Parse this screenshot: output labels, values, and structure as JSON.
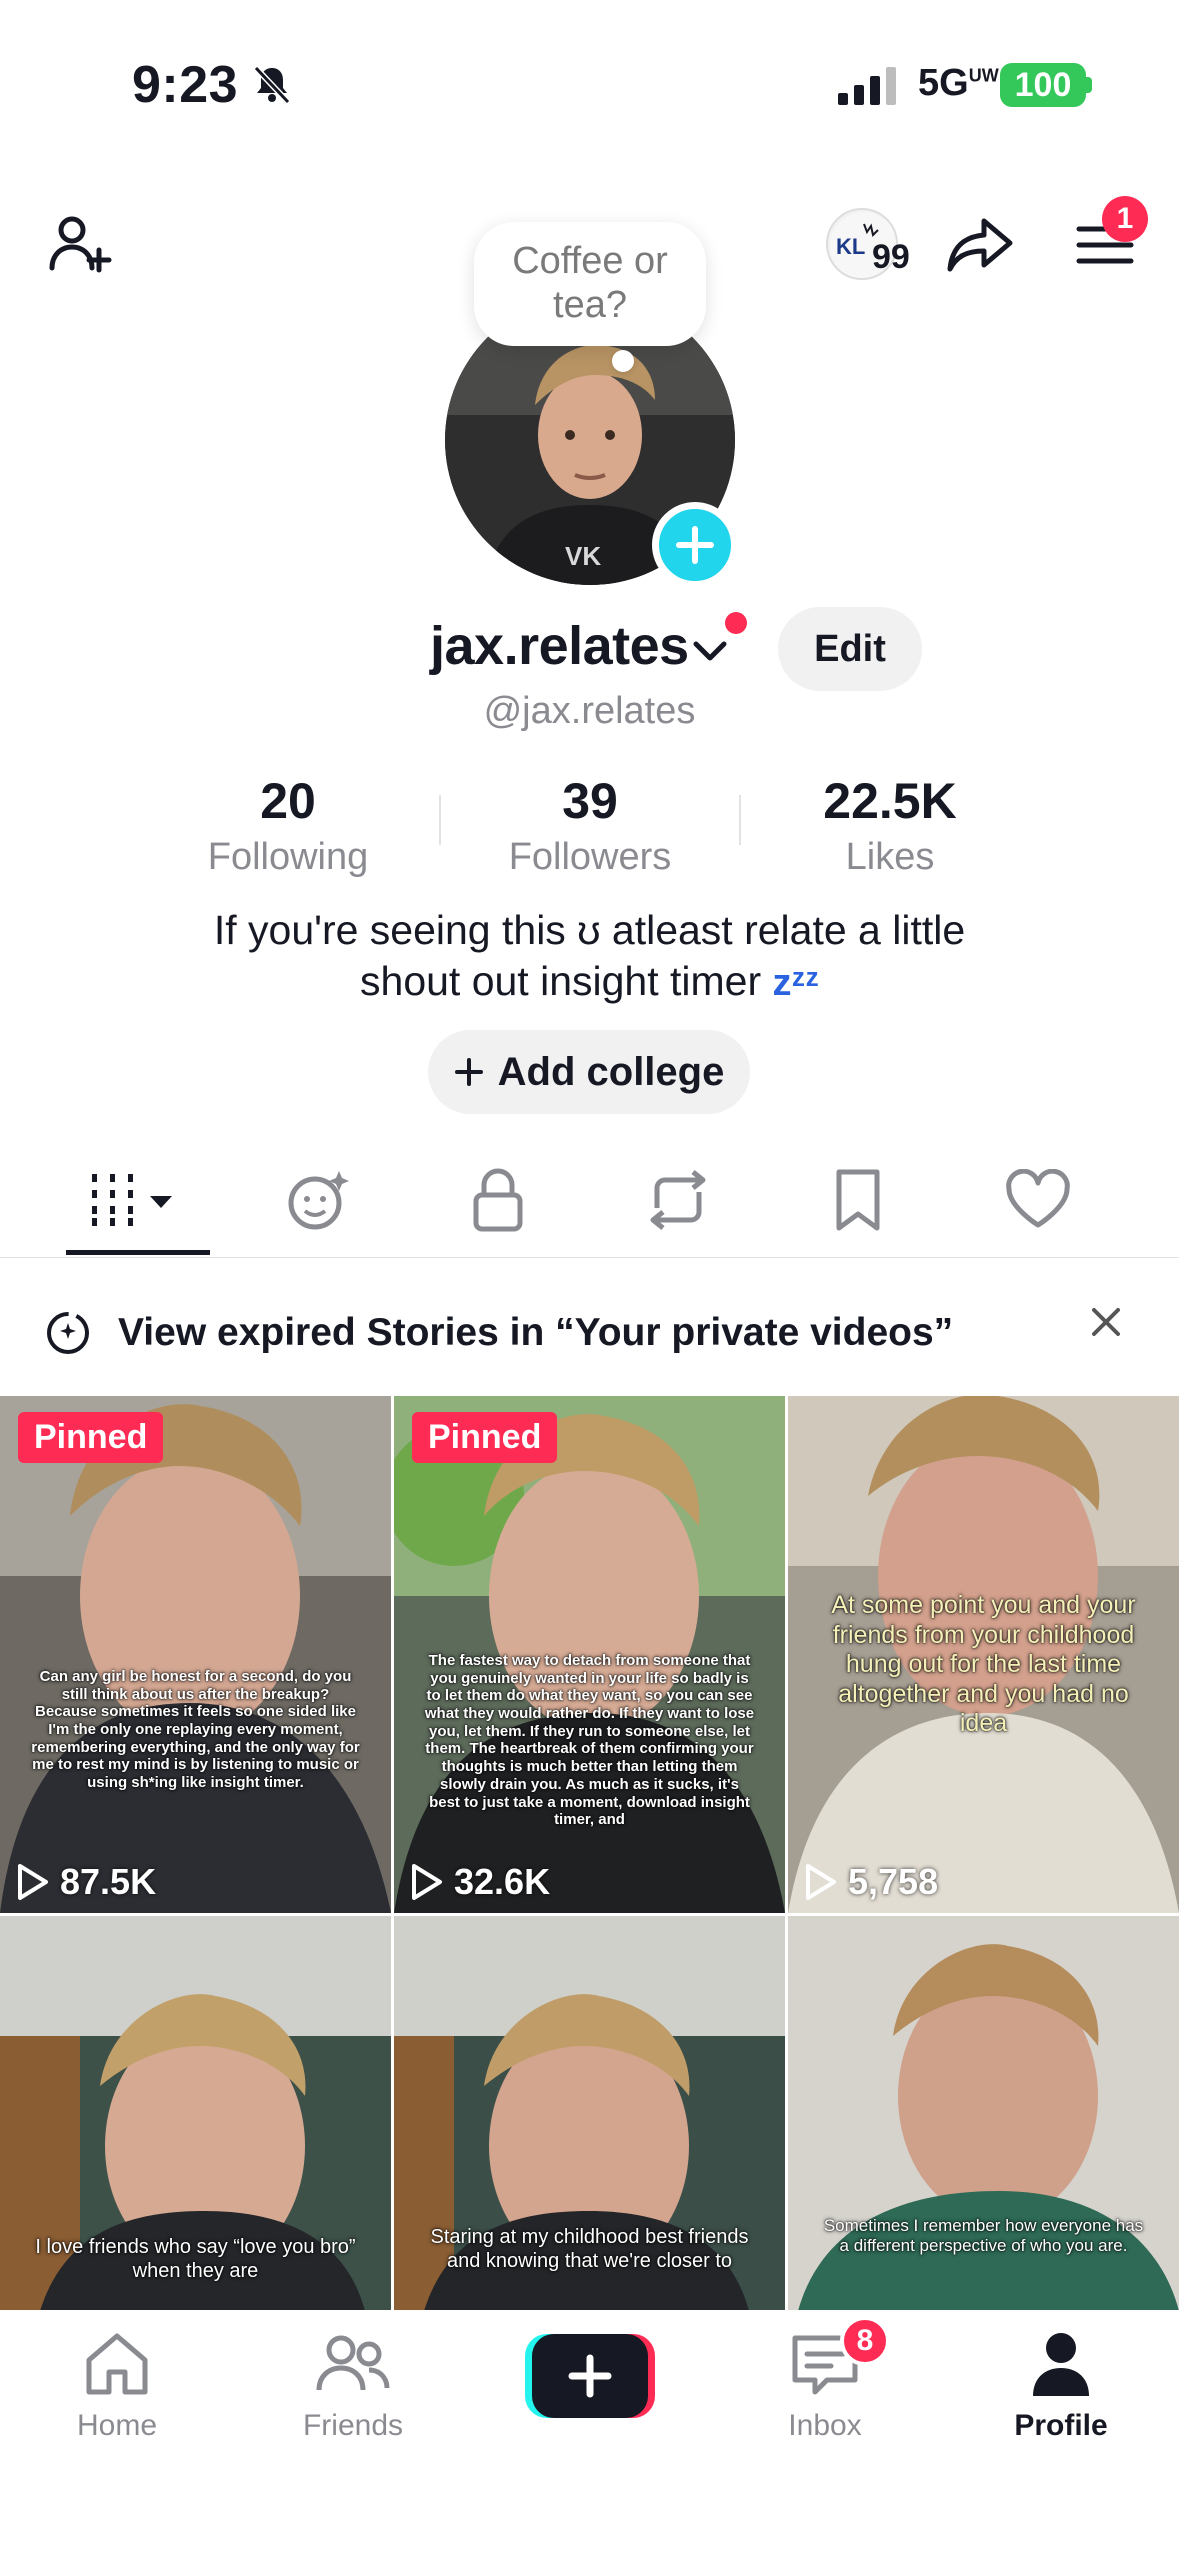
{
  "status_bar": {
    "time": "9:23",
    "network": "5G",
    "network_sub": "UW",
    "battery": "100"
  },
  "header": {
    "coins_count": "99",
    "menu_badge": "1"
  },
  "note": {
    "text": "Coffee or tea?"
  },
  "profile": {
    "username": "jax.relates",
    "handle": "@jax.relates",
    "edit_label": "Edit",
    "stats": [
      {
        "value": "20",
        "label": "Following"
      },
      {
        "value": "39",
        "label": "Followers"
      },
      {
        "value": "22.5K",
        "label": "Likes"
      }
    ],
    "bio_line1": "If you're seeing this ʊ atleast relate a little",
    "bio_line2": "shout out insight timer",
    "bio_emoji": "zᶻᶻ",
    "add_college_label": "Add college"
  },
  "tabs": [
    "videos-icon",
    "stories-icon",
    "private-icon",
    "reposts-icon",
    "favorites-icon",
    "liked-icon"
  ],
  "banner": {
    "text": "View expired Stories in “Your private videos”"
  },
  "videos": [
    {
      "pinned": "Pinned",
      "views": "87.5K",
      "caption": "Can any girl be honest for a second, do you still think about us after the breakup? Because sometimes it feels so one sided like I'm the only one replaying every moment, remembering everything, and the only way for me to rest my mind is by listening to music or using sh*ing like insight timer."
    },
    {
      "pinned": "Pinned",
      "views": "32.6K",
      "caption": "The fastest way to detach from someone that you genuinely wanted in your life so badly is to let them do what they want, so you can see what they would rather do. If they want to lose you, let them. If they run to someone else, let them. The heartbreak of them confirming your thoughts is much better than letting them slowly drain you. As much as it sucks, it's best to just take a moment, download insight timer, and"
    },
    {
      "pinned": "",
      "views": "5,758",
      "caption": "At some point you and your friends from your childhood hung out for the last time altogether and you had no idea"
    },
    {
      "pinned": "",
      "views": "",
      "caption": "I love friends who say “love you bro” when they are"
    },
    {
      "pinned": "",
      "views": "",
      "caption": "Staring at my childhood best friends and knowing that we're closer to"
    },
    {
      "pinned": "",
      "views": "",
      "caption": "Sometimes I remember how everyone has a different perspective of who you are."
    }
  ],
  "nav": {
    "home": "Home",
    "friends": "Friends",
    "inbox": "Inbox",
    "inbox_badge": "8",
    "profile": "Profile"
  }
}
